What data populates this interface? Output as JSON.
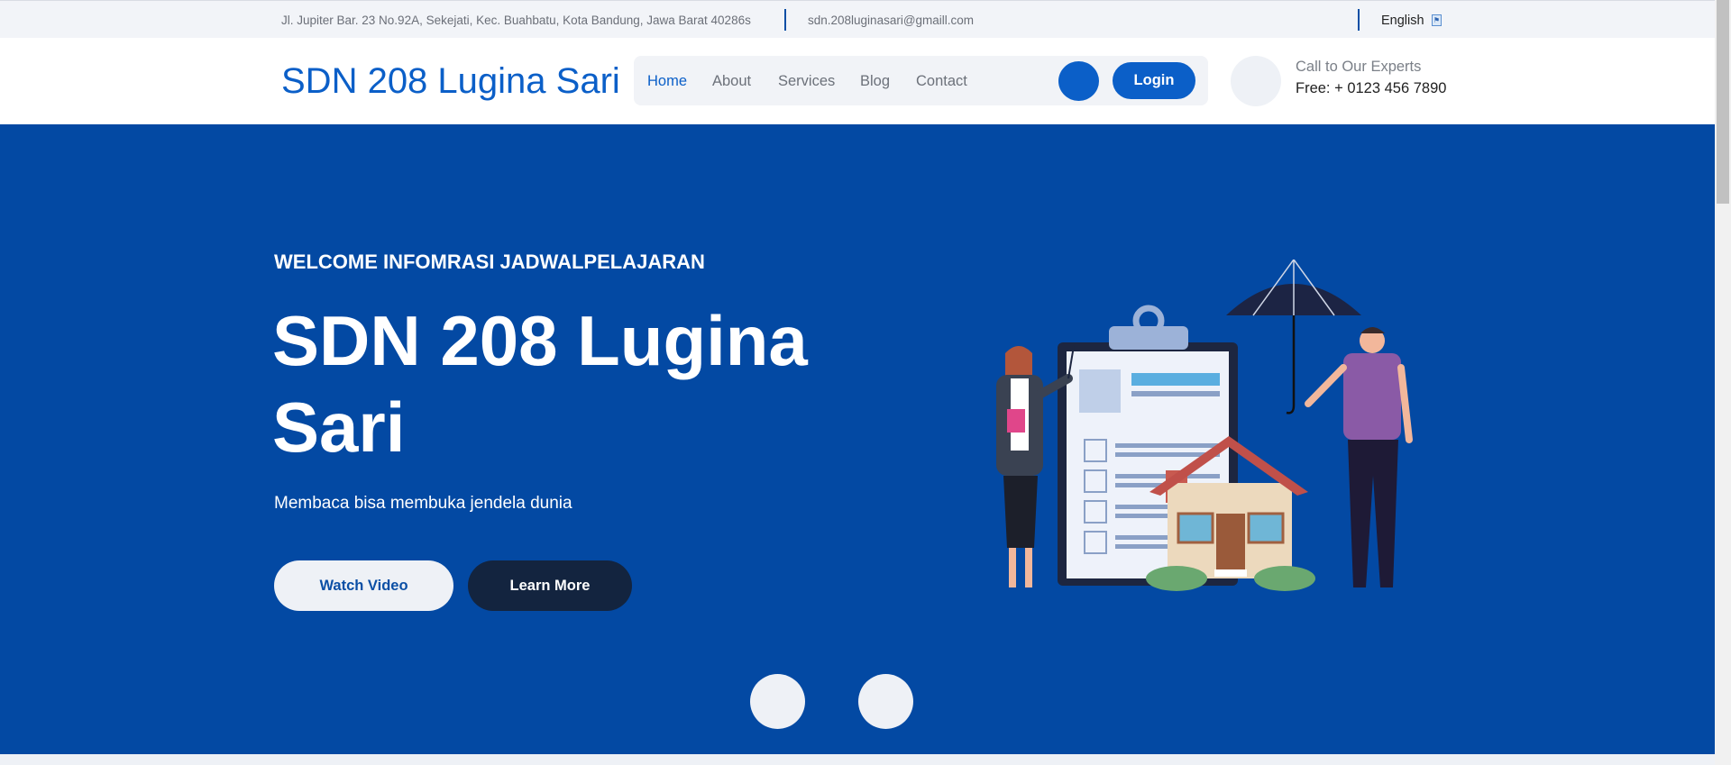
{
  "topbar": {
    "address": "Jl. Jupiter Bar. 23 No.92A, Sekejati, Kec. Buahbatu, Kota Bandung, Jawa Barat 40286s",
    "email": "sdn.208luginasari@gmaill.com",
    "language": "English"
  },
  "header": {
    "logo": "SDN 208 Lugina Sari",
    "nav": [
      "Home",
      "About",
      "Services",
      "Blog",
      "Contact"
    ],
    "active_nav": "Home",
    "login_label": "Login",
    "call_label": "Call to Our Experts",
    "call_number": "Free: + 0123 456 7890"
  },
  "hero": {
    "eyebrow": "WELCOME INFOMRASI JADWALPELAJARAN",
    "title": "SDN 208 Lugina Sari",
    "subtitle": "Membaca bisa membuka jendela dunia",
    "watch_label": "Watch Video",
    "learn_label": "Learn More"
  },
  "colors": {
    "accent": "#0b5fc8",
    "hero_bg": "#0349a3",
    "dark_button": "#13243f"
  }
}
